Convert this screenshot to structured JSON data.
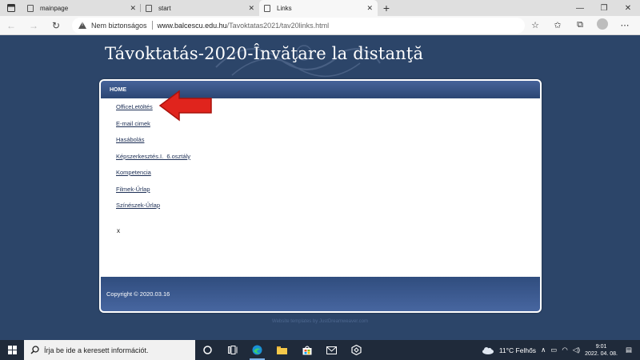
{
  "browser": {
    "tabs": [
      {
        "title": "mainpage",
        "active": false
      },
      {
        "title": "start",
        "active": false
      },
      {
        "title": "Links",
        "active": true
      }
    ],
    "new_tab": "+",
    "close_glyph": "✕",
    "window_controls": {
      "minimize": "—",
      "restore": "❐",
      "close": "✕"
    },
    "security_text": "Nem biztonságos",
    "url_host": "www.balcescu.edu.hu",
    "url_path": "/Tavoktatas2021/tav20links.html",
    "nav": {
      "back": "←",
      "forward": "→",
      "reload": "↻"
    },
    "toolbar_icons": [
      "favorite-add-icon",
      "favorites-icon",
      "collections-icon",
      "profile-avatar-icon",
      "more-icon"
    ]
  },
  "page": {
    "site_title": "Távoktatás-2020-Învăţare la distanţă",
    "nav_home": "HOME",
    "links": [
      "OfficeLetöltés",
      "E-mail cimek",
      "Hasábolás",
      "Képszerkesztés.I._6.osztály",
      "Kompetencia",
      "Filmek-Űrlap",
      "Színészek-Űrlap"
    ],
    "x_text": "x",
    "copyright": "Copyright © 2020.03.16",
    "credit": "Website templates by JustDreamweaver.com",
    "arrow_color": "#e0241d"
  },
  "taskbar": {
    "search_placeholder": "Írja be ide a keresett információt.",
    "weather": "11°C  Felhős",
    "time": "9:01",
    "date": "2022. 04. 08."
  }
}
